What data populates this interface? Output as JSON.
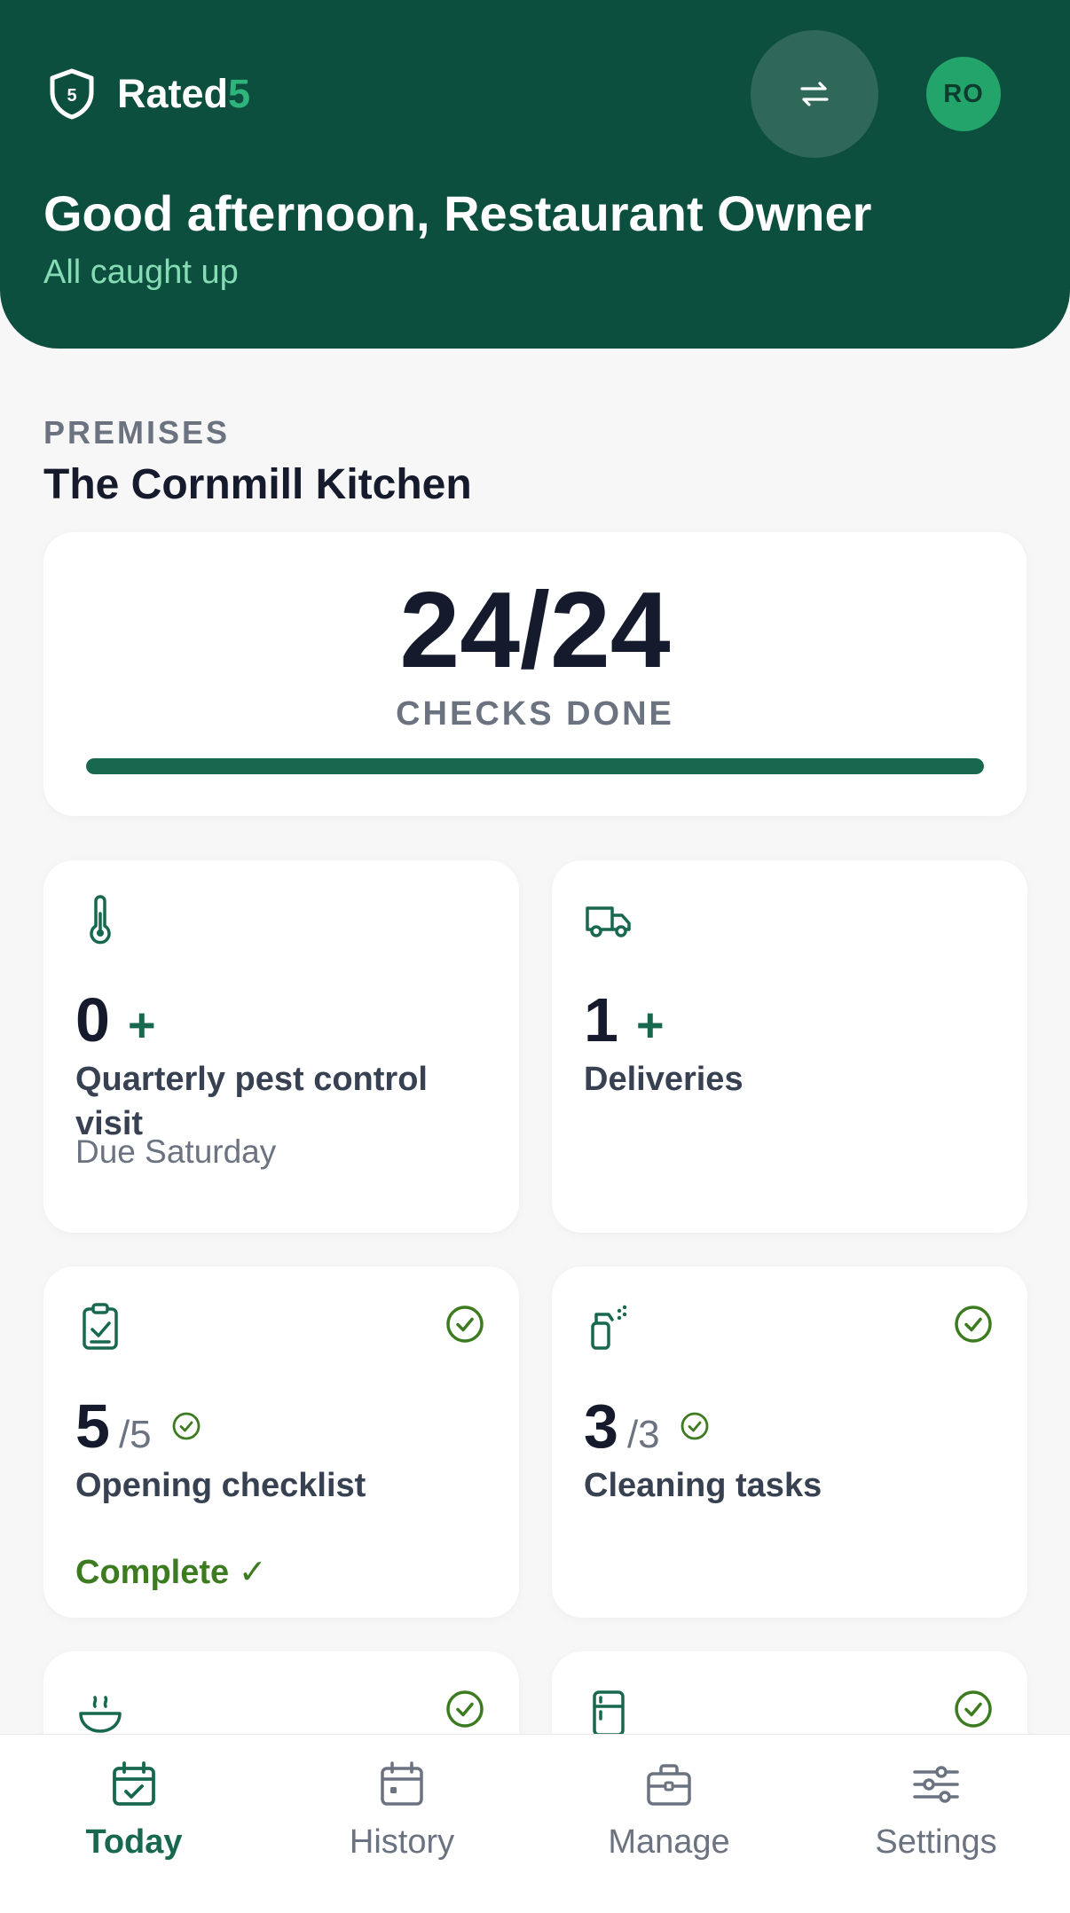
{
  "colors": {
    "header_bg": "#0d4f3e",
    "brand_accent": "#2fb47c",
    "primary": "#17684f",
    "success": "#3c7b1f",
    "avatar_bg": "#22a46a"
  },
  "header": {
    "brand_name": "Rated",
    "brand_number": "5",
    "logo_icon": "shield-5-icon",
    "switch_icon": "swap-arrows-icon",
    "avatar_initials": "RO",
    "greeting": "Good afternoon, Restaurant Owner",
    "status": "All caught up"
  },
  "premises": {
    "label": "PREMISES",
    "name": "The Cornmill Kitchen"
  },
  "summary": {
    "count": "24/24",
    "label": "CHECKS DONE",
    "progress_fraction": 1.0
  },
  "tiles": [
    {
      "icon": "thermometer-icon",
      "count": "0",
      "plus": "+",
      "title": "Quarterly pest control visit",
      "sub": "Due Saturday"
    },
    {
      "icon": "truck-icon",
      "count": "1",
      "plus": "+",
      "title": "Deliveries"
    },
    {
      "icon": "clipboard-check-icon",
      "count": "5",
      "total": "/5",
      "title": "Opening checklist",
      "status": "Complete ✓"
    },
    {
      "icon": "spray-bottle-icon",
      "count": "3",
      "total": "/3",
      "title": "Cleaning tasks"
    },
    {
      "icon": "bowl-icon"
    },
    {
      "icon": "fridge-icon"
    }
  ],
  "nav": [
    {
      "label": "Today",
      "icon": "calendar-check-icon",
      "active": true
    },
    {
      "label": "History",
      "icon": "calendar-icon",
      "active": false
    },
    {
      "label": "Manage",
      "icon": "briefcase-icon",
      "active": false
    },
    {
      "label": "Settings",
      "icon": "sliders-icon",
      "active": false
    }
  ]
}
